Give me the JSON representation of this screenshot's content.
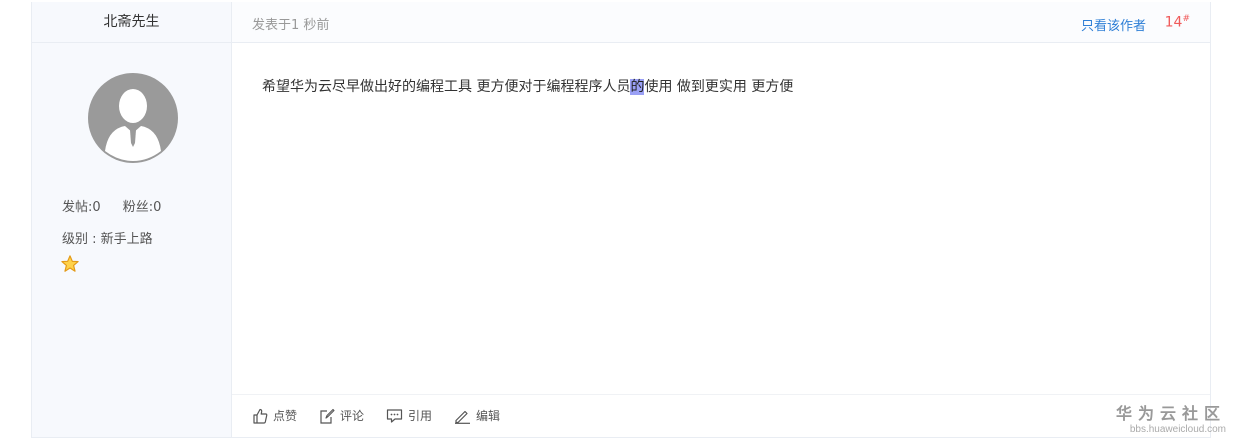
{
  "author": {
    "name": "北斋先生",
    "posts_label": "发帖:0",
    "fans_label": "粉丝:0",
    "level_label": "级别 : 新手上路"
  },
  "post": {
    "time": "发表于1 秒前",
    "only_author": "只看该作者",
    "floor": "14",
    "floor_mark": "#",
    "content_before": "希望华为云尽早做出好的编程工具 更方便对于编程程序人员",
    "content_highlight": "的",
    "content_after": "使用  做到更实用 更方便"
  },
  "actions": {
    "like": "点赞",
    "comment": "评论",
    "quote": "引用",
    "edit": "编辑"
  },
  "watermark": {
    "title": "华为云社区",
    "url": "bbs.huaweicloud.com"
  },
  "colors": {
    "link": "#2f7fd6",
    "floor": "#f05a5a",
    "highlight": "#9aa0f5",
    "sidebar_bg": "#f7f9fd"
  }
}
